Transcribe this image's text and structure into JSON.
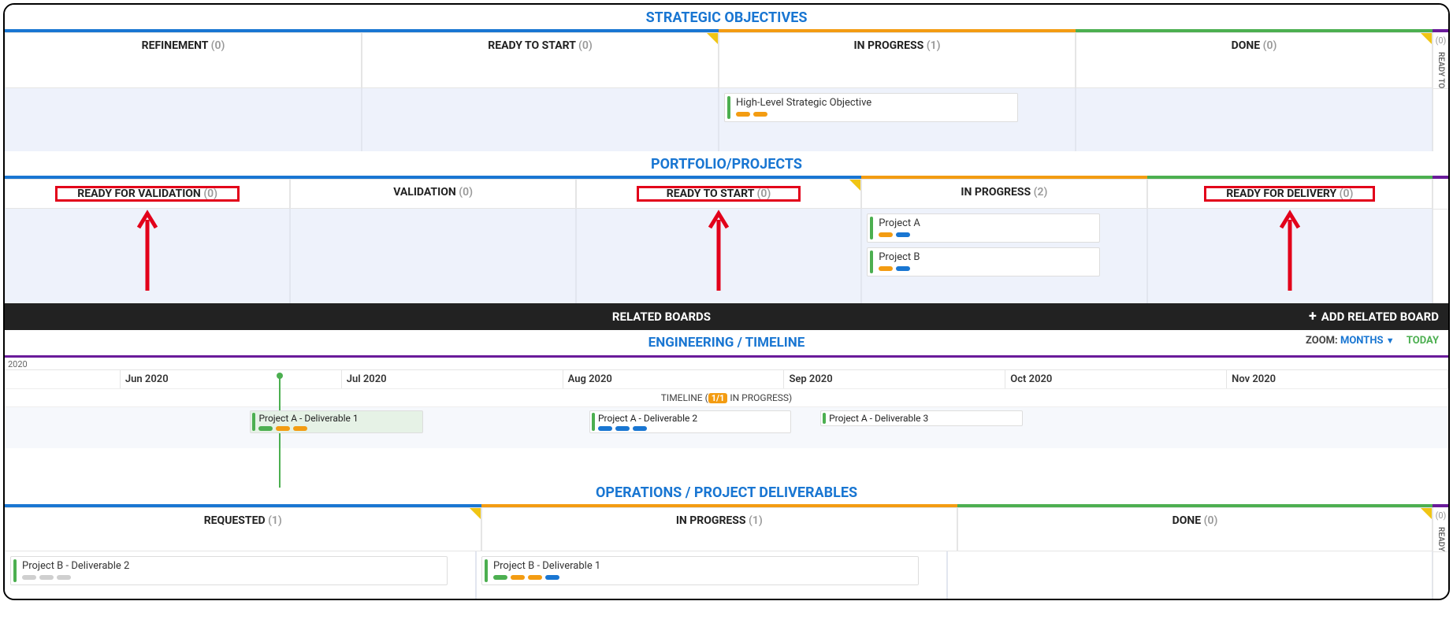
{
  "strategic": {
    "title": "STRATEGIC OBJECTIVES",
    "columns": [
      {
        "label": "REFINEMENT",
        "count": "(0)",
        "bar": "seg-blue"
      },
      {
        "label": "READY TO START",
        "count": "(0)",
        "bar": "seg-blue"
      },
      {
        "label": "IN PROGRESS",
        "count": "(1)",
        "bar": "seg-orange"
      },
      {
        "label": "DONE",
        "count": "(0)",
        "bar": "seg-green"
      }
    ],
    "collapsed": {
      "count": "(0)",
      "label": "READY TO"
    },
    "card": {
      "title": "High-Level Strategic Objective"
    }
  },
  "portfolio": {
    "title": "PORTFOLIO/PROJECTS",
    "columns": [
      {
        "label": "READY FOR VALIDATION",
        "count": "(0)",
        "bar": "seg-blue",
        "hl": true,
        "arrow": true
      },
      {
        "label": "VALIDATION",
        "count": "(0)",
        "bar": "seg-blue"
      },
      {
        "label": "READY TO START",
        "count": "(0)",
        "bar": "seg-blue",
        "hl": true,
        "arrow": true
      },
      {
        "label": "IN PROGRESS",
        "count": "(2)",
        "bar": "seg-orange"
      },
      {
        "label": "READY FOR DELIVERY",
        "count": "(0)",
        "bar": "seg-green",
        "hl": true,
        "arrow": true
      }
    ],
    "cards": [
      {
        "title": "Project A"
      },
      {
        "title": "Project B"
      }
    ]
  },
  "related_bar": {
    "center": "RELATED BOARDS",
    "add": "ADD RELATED BOARD"
  },
  "timeline": {
    "title": "ENGINEERING / TIMELINE",
    "zoom_label": "ZOOM:",
    "zoom_value": "MONTHS",
    "today": "TODAY",
    "year": "2020",
    "months": [
      "",
      "Jun 2020",
      "Jul 2020",
      "Aug 2020",
      "Sep 2020",
      "Oct 2020",
      "Nov 2020"
    ],
    "status_prefix": "TIMELINE (",
    "status_badge": "1/1",
    "status_suffix": " IN PROGRESS)",
    "items": [
      {
        "title": "Project A - Deliverable 1",
        "left": "17%",
        "width": "12%",
        "chips": [
          "c-gn",
          "c-or",
          "c-or"
        ],
        "active": true
      },
      {
        "title": "Project A - Deliverable 2",
        "left": "40.5%",
        "width": "14%",
        "chips": [
          "c-bl",
          "c-bl",
          "c-bl"
        ]
      },
      {
        "title": "Project A - Deliverable 3",
        "left": "56.5%",
        "width": "14%",
        "chips": []
      }
    ],
    "now": "19%"
  },
  "operations": {
    "title": "OPERATIONS / PROJECT DELIVERABLES",
    "columns": [
      {
        "label": "REQUESTED",
        "count": "(1)",
        "bar": "seg-blue"
      },
      {
        "label": "IN PROGRESS",
        "count": "(1)",
        "bar": "seg-orange"
      },
      {
        "label": "DONE",
        "count": "(0)",
        "bar": "seg-green"
      }
    ],
    "collapsed": {
      "count": "(0)",
      "label": "READY"
    },
    "cards": [
      {
        "col": 0,
        "title": "Project B - Deliverable 2",
        "chips": [
          "c-gy",
          "c-gy",
          "c-gy"
        ]
      },
      {
        "col": 1,
        "title": "Project B - Deliverable 1",
        "chips": [
          "c-gn",
          "c-or",
          "c-or",
          "c-bl"
        ]
      }
    ]
  }
}
